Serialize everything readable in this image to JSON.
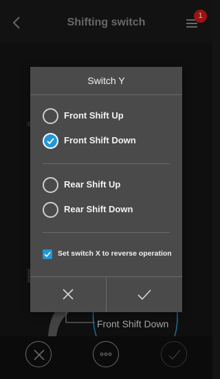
{
  "header": {
    "title": "Shifting switch",
    "badge_count": "1",
    "back_icon": "chevron-left-icon",
    "menu_icon": "menu-list-icon"
  },
  "background": {
    "label": "Front Shift Down"
  },
  "dialog": {
    "title": "Switch Y",
    "front_options": [
      {
        "label": "Front Shift Up",
        "checked": false
      },
      {
        "label": "Front Shift Down",
        "checked": true
      }
    ],
    "rear_options": [
      {
        "label": "Rear Shift Up",
        "checked": false
      },
      {
        "label": "Rear Shift Down",
        "checked": false
      }
    ],
    "checkbox": {
      "label": "Set switch X to reverse operation",
      "checked": true
    },
    "cancel_icon": "close-icon",
    "confirm_icon": "check-icon"
  },
  "footer": {
    "buttons": [
      "close-icon",
      "more-icon",
      "check-icon"
    ]
  },
  "colors": {
    "accent": "#2196d8",
    "badge": "#d11a1a",
    "dialog_bg": "#4a4a4a"
  }
}
